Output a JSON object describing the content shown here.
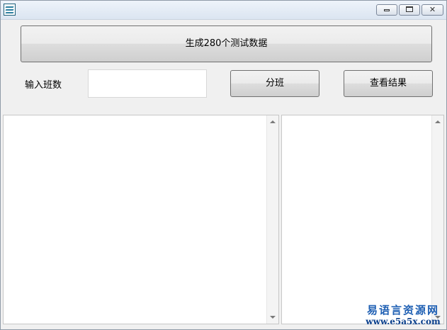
{
  "toolbar": {
    "generate_label": "生成280个测试数据",
    "split_label": "分班",
    "view_result_label": "查看结果"
  },
  "form": {
    "class_count_label": "输入班数",
    "class_count_value": ""
  },
  "watermark": {
    "text_cn": "易语言资源网",
    "url": "www.e5a5x.com"
  }
}
